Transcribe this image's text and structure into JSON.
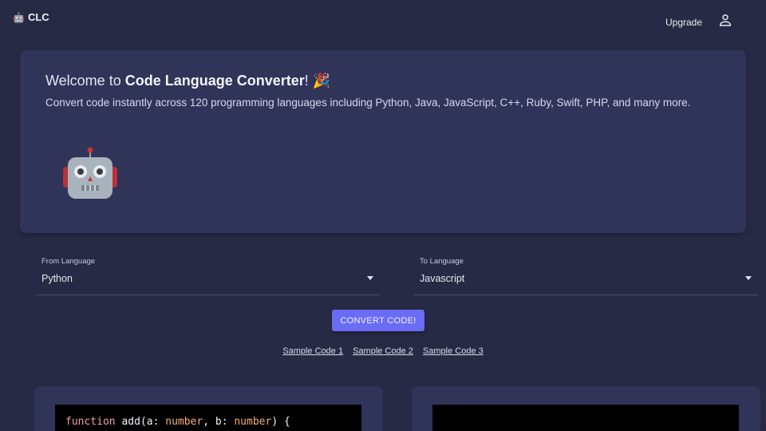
{
  "topbar": {
    "brand": "CLC",
    "brand_icon": "robot-icon",
    "upgrade_label": "Upgrade",
    "user_icon": "user-icon"
  },
  "hero": {
    "title_prefix": "Welcome to ",
    "title_strong": "Code Language Converter",
    "title_suffix": "! 🎉",
    "subtitle": "Convert code instantly across 120 programming languages including Python, Java, JavaScript, C++, Ruby, Swift, PHP, and many more.",
    "illustration": "robot-illustration"
  },
  "from_language": {
    "label": "From Language",
    "value": "Python"
  },
  "to_language": {
    "label": "To Language",
    "value": "Javascript"
  },
  "convert_label": "CONVERT CODE!",
  "samples": [
    "Sample Code 1",
    "Sample Code 2",
    "Sample Code 3"
  ],
  "input_code": {
    "keyword": "function",
    "name": "add",
    "open": "(",
    "param1": "a",
    "type1": "number",
    "sep": ", ",
    "param2": "b",
    "type2": "number",
    "close": ") {",
    "colon": ": "
  },
  "colors": {
    "background": "#272a44",
    "card": "#303459",
    "accent": "#6a6cf5",
    "editor": "#000000"
  }
}
